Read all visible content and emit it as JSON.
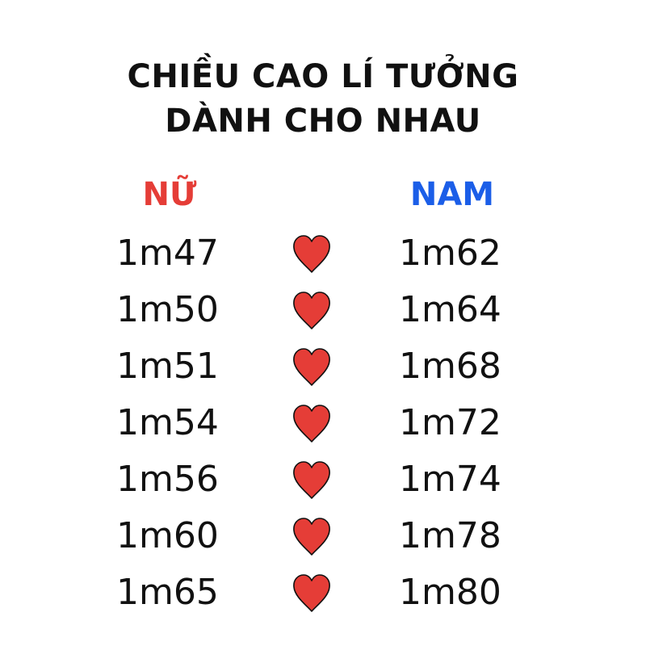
{
  "title": {
    "line1": "CHIỀU CAO LÍ TƯỞNG",
    "line2": "DÀNH CHO NHAU"
  },
  "headers": {
    "female": "NỮ",
    "male": "NAM"
  },
  "colors": {
    "female_header": "#e53d37",
    "male_header": "#1b5ee8",
    "heart_fill": "#e53d37",
    "heart_stroke": "#111111",
    "text": "#111111",
    "background": "#ffffff"
  },
  "pairs": [
    {
      "female": "1m47",
      "male": "1m62",
      "icon": "heart-icon"
    },
    {
      "female": "1m50",
      "male": "1m64",
      "icon": "heart-icon"
    },
    {
      "female": "1m51",
      "male": "1m68",
      "icon": "heart-icon"
    },
    {
      "female": "1m54",
      "male": "1m72",
      "icon": "heart-icon"
    },
    {
      "female": "1m56",
      "male": "1m74",
      "icon": "heart-icon"
    },
    {
      "female": "1m60",
      "male": "1m78",
      "icon": "heart-icon"
    },
    {
      "female": "1m65",
      "male": "1m80",
      "icon": "heart-icon"
    }
  ]
}
